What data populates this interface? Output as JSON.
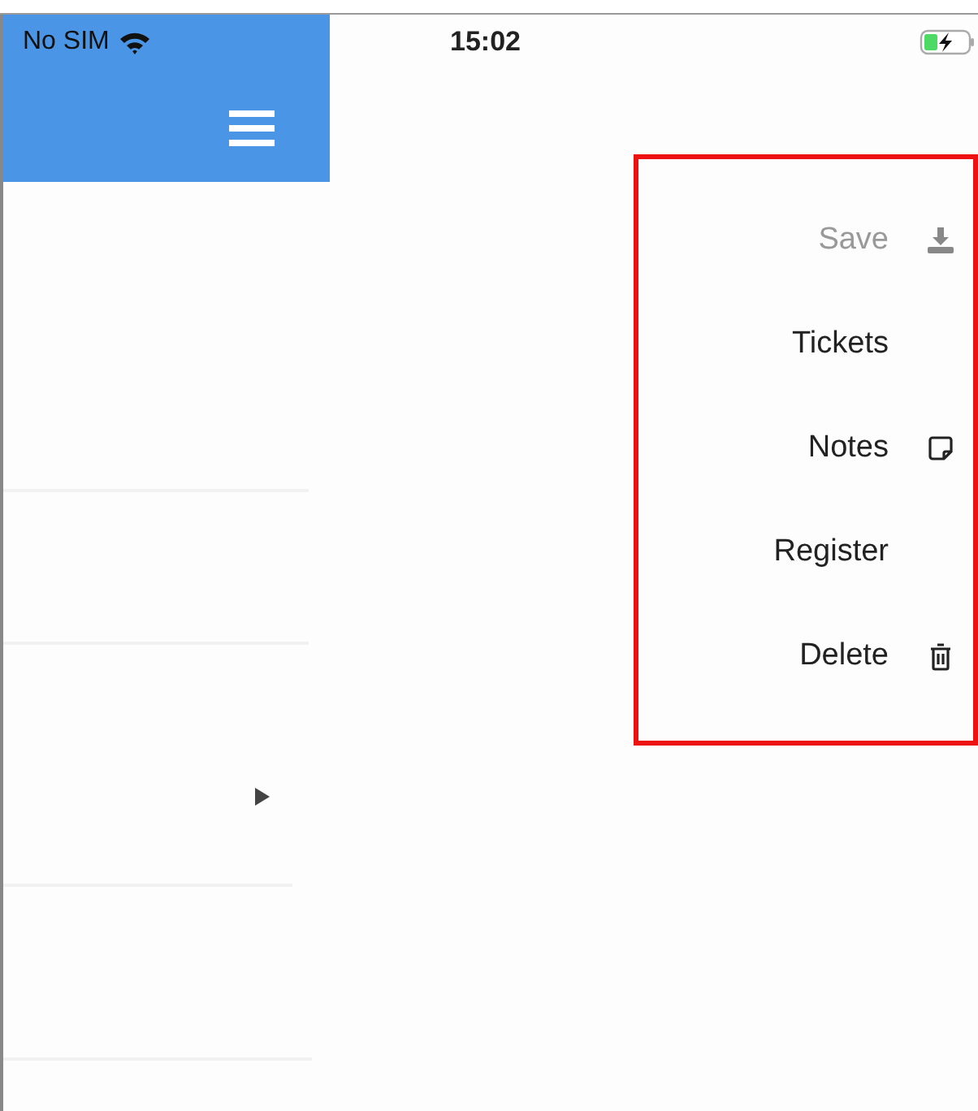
{
  "status_bar": {
    "carrier": "No SIM",
    "time": "15:02"
  },
  "side_rows": [
    {
      "kind": "plain"
    },
    {
      "kind": "plain"
    },
    {
      "kind": "arrow"
    },
    {
      "kind": "plain"
    }
  ],
  "menu": {
    "items": [
      {
        "label": "Save",
        "disabled": true,
        "kind": "download"
      },
      {
        "label": "Tickets",
        "disabled": false,
        "kind": "plain"
      },
      {
        "label": "Notes",
        "disabled": false,
        "kind": "note"
      },
      {
        "label": "Register",
        "disabled": false,
        "kind": "plain"
      },
      {
        "label": "Delete",
        "disabled": false,
        "kind": "trash"
      }
    ]
  }
}
